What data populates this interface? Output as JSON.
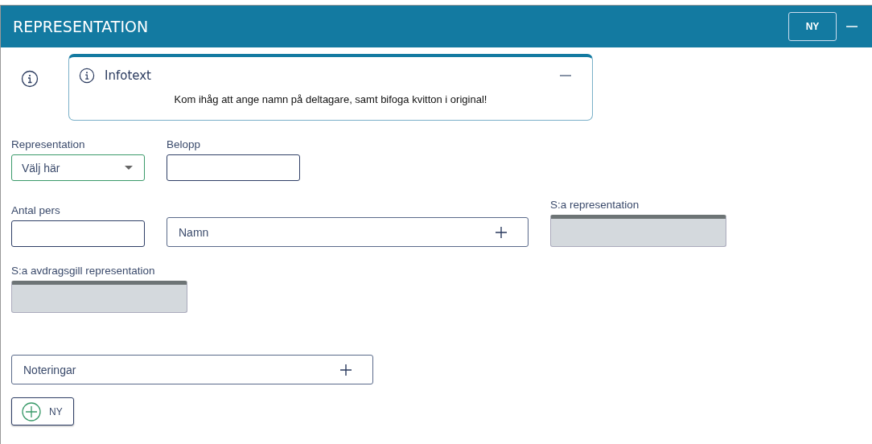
{
  "header": {
    "title": "REPRESENTATION",
    "new_button": "NY"
  },
  "info": {
    "title": "Infotext",
    "message": "Kom ihåg att ange namn på deltagare, samt bifoga kvitton i original!"
  },
  "form_rows": [
    [
      {
        "kind": "select",
        "label": "Representation",
        "value": "Välj här"
      },
      {
        "kind": "input",
        "label": "Belopp"
      }
    ],
    [
      {
        "kind": "input",
        "label": "Antal pers"
      },
      {
        "kind": "add",
        "placeholder": "Namn"
      },
      {
        "kind": "readonly",
        "label": "S:a representation"
      }
    ],
    [
      {
        "kind": "readonly",
        "label": "S:a avdragsgill representation"
      }
    ]
  ],
  "notes": {
    "placeholder": "Noteringar"
  },
  "add_button": "NY"
}
